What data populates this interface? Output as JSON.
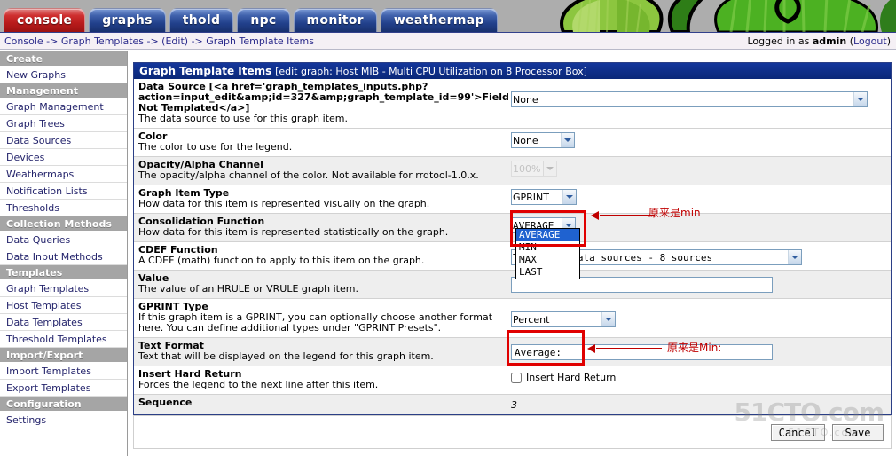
{
  "nav": {
    "tabs": [
      {
        "label": "console",
        "active": true
      },
      {
        "label": "graphs",
        "active": false
      },
      {
        "label": "thold",
        "active": false
      },
      {
        "label": "npc",
        "active": false
      },
      {
        "label": "monitor",
        "active": false
      },
      {
        "label": "weathermap",
        "active": false
      }
    ]
  },
  "breadcrumb": {
    "text": "Console -> Graph Templates -> (Edit) -> Graph Template Items"
  },
  "session": {
    "prefix": "Logged in as ",
    "user": "admin",
    "logout_open": " (",
    "logout": "Logout",
    "logout_close": ")"
  },
  "sidebar": {
    "sections": [
      {
        "header": "Create",
        "items": [
          "New Graphs"
        ]
      },
      {
        "header": "Management",
        "items": [
          "Graph Management",
          "Graph Trees",
          "Data Sources",
          "Devices",
          "Weathermaps",
          "Notification Lists",
          "Thresholds"
        ]
      },
      {
        "header": "Collection Methods",
        "items": [
          "Data Queries",
          "Data Input Methods"
        ]
      },
      {
        "header": "Templates",
        "items": [
          "Graph Templates",
          "Host Templates",
          "Data Templates",
          "Threshold Templates"
        ]
      },
      {
        "header": "Import/Export",
        "items": [
          "Import Templates",
          "Export Templates"
        ]
      },
      {
        "header": "Configuration",
        "items": [
          "Settings"
        ]
      }
    ]
  },
  "panel": {
    "title": "Graph Template Items",
    "subtitle": "[edit graph: Host MIB - Multi CPU Utilization on 8 Processor Box]"
  },
  "form": {
    "data_source": {
      "label": "Data Source [<a href='graph_templates_inputs.php?action=input_edit&amp;id=327&amp;graph_template_id=99'>Field Not Templated</a>]",
      "desc": "The data source to use for this graph item.",
      "value": "None"
    },
    "color": {
      "label": "Color",
      "desc": "The color to use for the legend.",
      "value": "None"
    },
    "opacity": {
      "label": "Opacity/Alpha Channel",
      "desc": "The opacity/alpha channel of the color. Not available for rrdtool-1.0.x.",
      "value": "100%"
    },
    "graph_item_type": {
      "label": "Graph Item Type",
      "desc": "How data for this item is represented visually on the graph.",
      "value": "GPRINT"
    },
    "consolidation_function": {
      "label": "Consolidation Function",
      "desc": "How data for this item is represented statistically on the graph.",
      "value": "AVERAGE",
      "options": [
        "AVERAGE",
        "MIN",
        "MAX",
        "LAST"
      ],
      "selected_option": "AVERAGE"
    },
    "cdef_function": {
      "label": "CDEF Function",
      "desc": "A CDEF (math) function to apply to this item on the graph.",
      "value": "Total All data sources - 8 sources"
    },
    "value": {
      "label": "Value",
      "desc": "The value of an HRULE or VRULE graph item.",
      "value": ""
    },
    "gprint_type": {
      "label": "GPRINT Type",
      "desc": "If this graph item is a GPRINT, you can optionally choose another format here. You can define additional types under \"GPRINT Presets\".",
      "value": "Percent"
    },
    "text_format": {
      "label": "Text Format",
      "desc": "Text that will be displayed on the legend for this graph item.",
      "value": "Average:"
    },
    "insert_hard_return": {
      "label": "Insert Hard Return",
      "desc": "Forces the legend to the next line after this item.",
      "checkbox_label": "Insert Hard Return",
      "checked": false
    },
    "sequence": {
      "label": "Sequence",
      "value": "3"
    }
  },
  "annotations": [
    {
      "text": "原来是min"
    },
    {
      "text": "原来是Min:"
    }
  ],
  "actions": {
    "cancel": "Cancel",
    "save": "Save"
  },
  "watermark": {
    "text": "51CTO.com",
    "sub": "51CTO.com"
  },
  "colors": {
    "active_tab": "#b81b1b",
    "tab": "#22418c",
    "panel_header": "#0a2878",
    "annotation_red": "#c00000",
    "select_highlight": "#1f62d0"
  }
}
